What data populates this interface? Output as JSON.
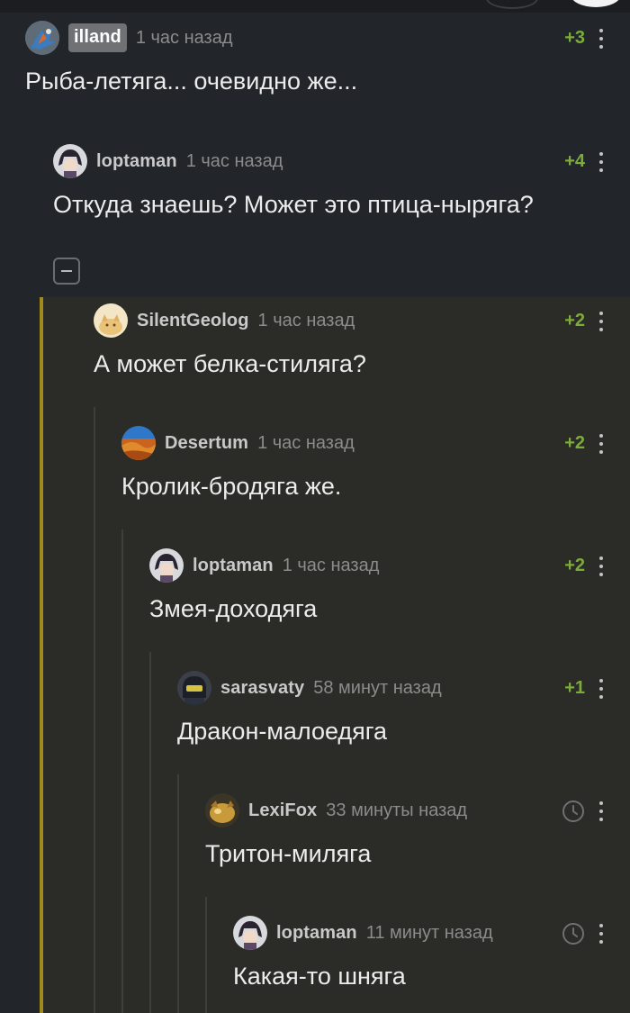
{
  "comments": [
    {
      "user": "illand",
      "time": "1 час назад",
      "score": "+3",
      "text": "Рыба-летяга... очевидно же...",
      "avatar": "raptor-avatar"
    },
    {
      "user": "loptaman",
      "time": "1 час назад",
      "score": "+4",
      "text": "Откуда знаешь? Может это птица-ныряга?",
      "avatar": "anime-avatar"
    },
    {
      "user": "SilentGeolog",
      "time": "1 час назад",
      "score": "+2",
      "text": "А может белка-стиляга?",
      "avatar": "cat-avatar"
    },
    {
      "user": "Desertum",
      "time": "1 час назад",
      "score": "+2",
      "text": "Кролик-бродяга же.",
      "avatar": "desert-avatar"
    },
    {
      "user": "loptaman",
      "time": "1 час назад",
      "score": "+2",
      "text": "Змея-доходяга",
      "avatar": "anime-avatar"
    },
    {
      "user": "sarasvaty",
      "time": "58 минут назад",
      "score": "+1",
      "text": "Дракон-малоедяга",
      "avatar": "helmet-avatar"
    },
    {
      "user": "LexiFox",
      "time": "33 минуты назад",
      "score": "",
      "text": "Тритон-миляга",
      "avatar": "fox-avatar",
      "pending_icon": "clock-icon"
    },
    {
      "user": "loptaman",
      "time": "11 минут назад",
      "score": "",
      "text": "Какая-то шняга",
      "avatar": "anime-avatar",
      "pending_icon": "clock-icon"
    }
  ],
  "colors": {
    "accent": "#a18a1c",
    "score": "#7cac3a",
    "background": "#22252a",
    "branch_background": "#2b2b27"
  }
}
